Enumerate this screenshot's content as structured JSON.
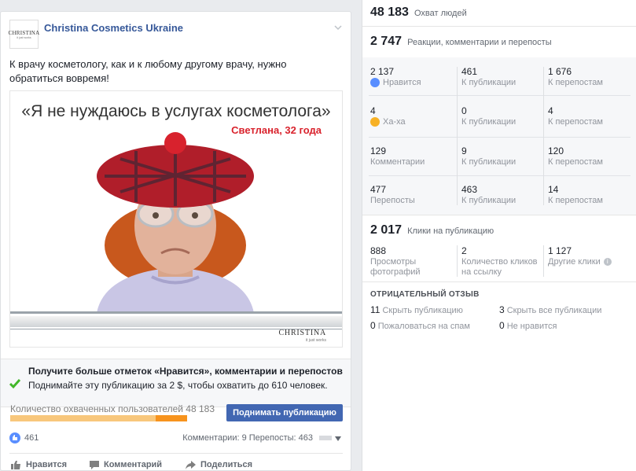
{
  "post": {
    "page_name": "Christina Cosmetics Ukraine",
    "avatar_brand": "CHRISTINA",
    "avatar_tagline": "it just works",
    "text": "К врачу косметологу, как и к любому другому врачу, нужно обратиться вовремя!",
    "image": {
      "quote": "«Я не нуждаюсь в услугах косметолога»",
      "subtitle": "Светлана, 32 года",
      "brand": "CHRISTINA",
      "slogan": "it just works"
    },
    "boost": {
      "title": "Получите больше отметок «Нравится», комментарии и перепостов",
      "subtitle": "Поднимайте эту публикацию за 2 $, чтобы охватить до 610 человек."
    },
    "reach_label": "Количество охваченных пользователей 48 183",
    "reach_fraction": 0.18,
    "boost_button": "Поднимать публикацию",
    "like_count": "461",
    "comments_shares": "Комментарии: 9   Перепосты: 463",
    "actions": {
      "like": "Нравится",
      "comment": "Комментарий",
      "share": "Поделиться"
    }
  },
  "panel": {
    "reach": {
      "value": "48 183",
      "label": "Охват людей"
    },
    "engagement": {
      "value": "2 747",
      "label": "Реакции, комментарии и перепосты"
    },
    "grid": [
      [
        {
          "value": "2 137",
          "label": "Нравится",
          "icon": "like-icon"
        },
        {
          "value": "461",
          "label": "К публикации"
        },
        {
          "value": "1 676",
          "label": "К перепостам"
        }
      ],
      [
        {
          "value": "4",
          "label": "Ха-ха",
          "icon": "haha-icon"
        },
        {
          "value": "0",
          "label": "К публикации"
        },
        {
          "value": "4",
          "label": "К перепостам"
        }
      ],
      [
        {
          "value": "129",
          "label": "Комментарии"
        },
        {
          "value": "9",
          "label": "К публикации"
        },
        {
          "value": "120",
          "label": "К перепостам"
        }
      ],
      [
        {
          "value": "477",
          "label": "Перепосты"
        },
        {
          "value": "463",
          "label": "К публикации"
        },
        {
          "value": "14",
          "label": "К перепостам"
        }
      ]
    ],
    "clicks": {
      "value": "2 017",
      "label": "Клики на публикацию",
      "items": [
        {
          "value": "888",
          "label": "Просмотры фотографий"
        },
        {
          "value": "2",
          "label": "Количество кликов на ссылку"
        },
        {
          "value": "1 127",
          "label": "Другие клики"
        }
      ]
    },
    "negative": {
      "title": "ОТРИЦАТЕЛЬНЫЙ ОТЗЫВ",
      "items": [
        {
          "value": "11",
          "label": "Скрыть публикацию"
        },
        {
          "value": "3",
          "label": "Скрыть все публикации"
        },
        {
          "value": "0",
          "label": "Пожаловаться на спам"
        },
        {
          "value": "0",
          "label": "Не нравится"
        }
      ]
    }
  }
}
